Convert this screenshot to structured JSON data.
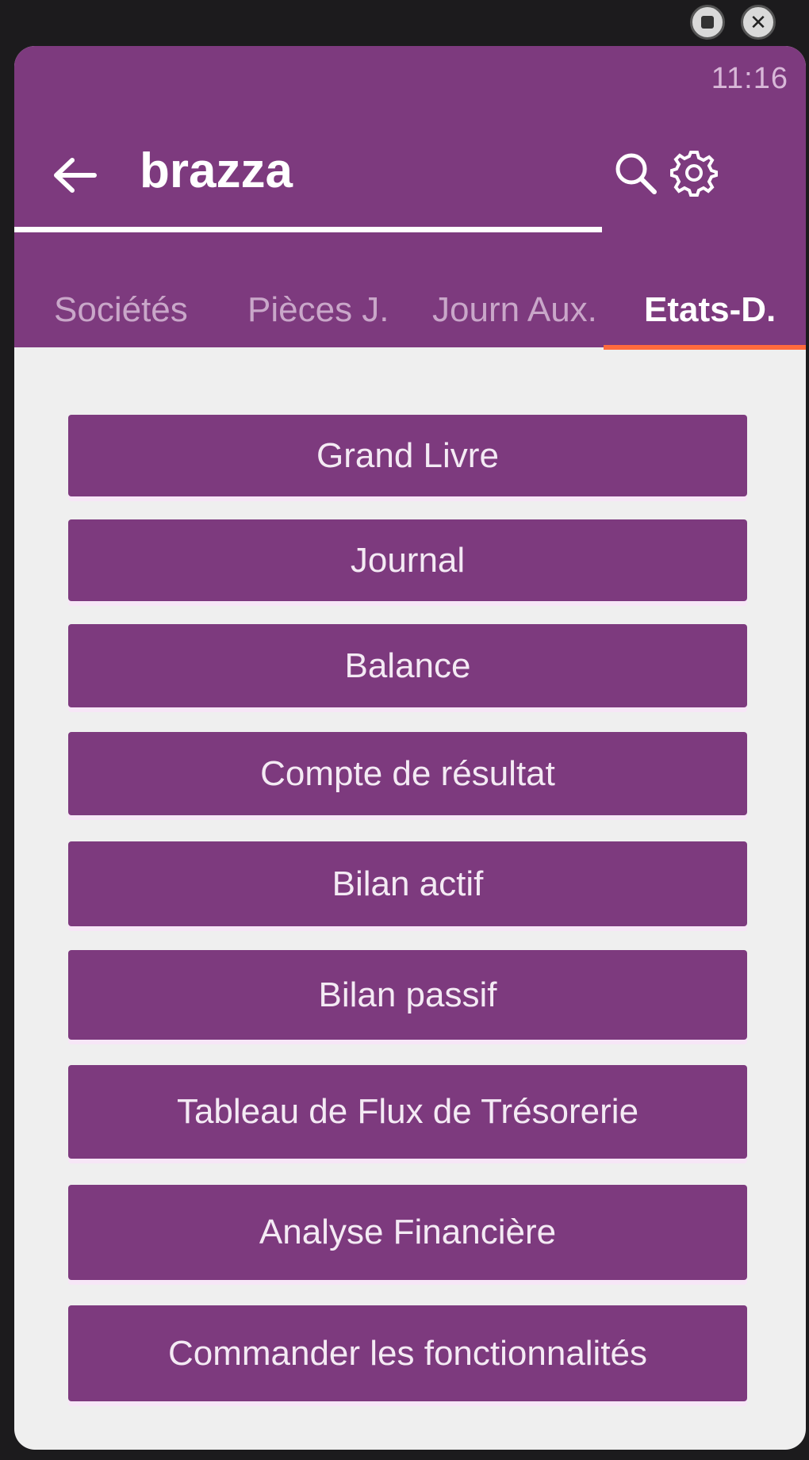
{
  "window_controls": {
    "minimize_icon": "square-dot-icon",
    "close_icon": "close-icon"
  },
  "status_bar": {
    "time": "11:16"
  },
  "app_bar": {
    "title": "brazza",
    "back_icon": "arrow-left-icon",
    "search_icon": "search-icon",
    "settings_icon": "gear-icon"
  },
  "tabs": [
    {
      "label": "Sociétés",
      "active": false
    },
    {
      "label": "Pièces J.",
      "active": false
    },
    {
      "label": "Journ Aux.",
      "active": false
    },
    {
      "label": "Etats-D.",
      "active": true
    }
  ],
  "menu": [
    {
      "label": "Grand Livre"
    },
    {
      "label": "Journal"
    },
    {
      "label": "Balance"
    },
    {
      "label": "Compte de résultat"
    },
    {
      "label": "Bilan actif"
    },
    {
      "label": "Bilan passif"
    },
    {
      "label": "Tableau de Flux de Trésorerie"
    },
    {
      "label": "Analyse Financière"
    },
    {
      "label": "Commander les fonctionnalités"
    }
  ],
  "colors": {
    "primary": "#7d3a7e",
    "tab_indicator": "#ff6a3d",
    "background": "#efefef"
  }
}
